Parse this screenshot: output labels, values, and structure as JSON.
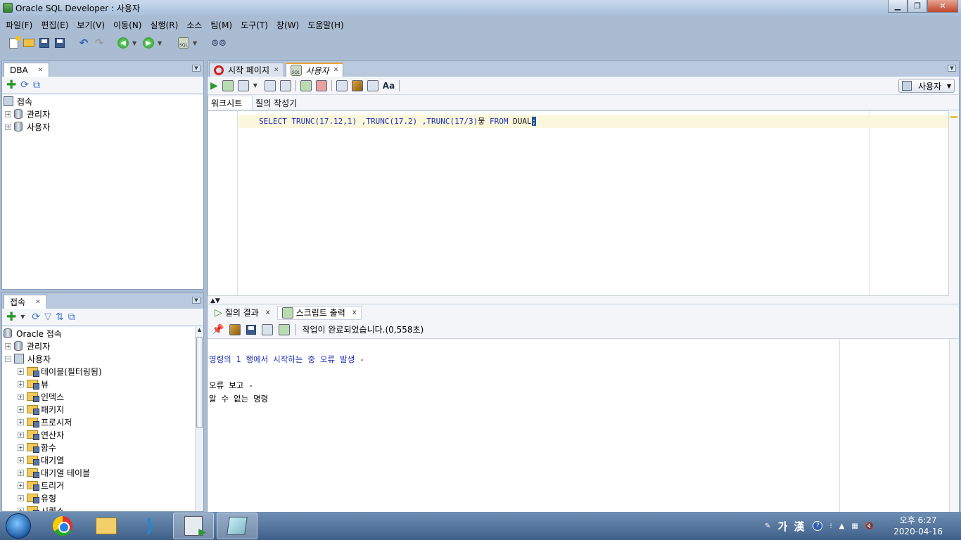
{
  "window": {
    "title": "Oracle SQL Developer : 사용자",
    "minimize": "▁",
    "maximize": "❐",
    "close": "✕"
  },
  "menu": [
    "파일(F)",
    "편집(E)",
    "보기(V)",
    "이동(N)",
    "실행(R)",
    "소스",
    "팀(M)",
    "도구(T)",
    "창(W)",
    "도움말(H)"
  ],
  "dba_panel": {
    "tab": "DBA",
    "tree": [
      {
        "label": "접속",
        "level": 0,
        "icon": "connection-icon"
      },
      {
        "label": "관리자",
        "level": 1,
        "expander": "+",
        "icon": "database-icon"
      },
      {
        "label": "사용자",
        "level": 1,
        "expander": "+",
        "icon": "database-icon"
      }
    ]
  },
  "connections_panel": {
    "tab": "접속",
    "tree": [
      {
        "label": "Oracle 접속",
        "level": 0,
        "icon": "database-icon"
      },
      {
        "label": "관리자",
        "level": 1,
        "expander": "+",
        "icon": "database-icon"
      },
      {
        "label": "사용자",
        "level": 1,
        "expander": "−",
        "icon": "connection-icon"
      },
      {
        "label": "테이블(필터링됨)",
        "level": 2,
        "expander": "+",
        "icon": "folder-icon"
      },
      {
        "label": "뷰",
        "level": 2,
        "expander": "+",
        "icon": "folder-icon"
      },
      {
        "label": "인덱스",
        "level": 2,
        "expander": "+",
        "icon": "folder-icon"
      },
      {
        "label": "패키지",
        "level": 2,
        "expander": "+",
        "icon": "folder-icon"
      },
      {
        "label": "프로시저",
        "level": 2,
        "expander": "+",
        "icon": "folder-icon"
      },
      {
        "label": "연산자",
        "level": 2,
        "expander": "+",
        "icon": "folder-icon"
      },
      {
        "label": "함수",
        "level": 2,
        "expander": "+",
        "icon": "folder-icon"
      },
      {
        "label": "대기열",
        "level": 2,
        "expander": "+",
        "icon": "folder-icon"
      },
      {
        "label": "대기열 테이블",
        "level": 2,
        "expander": "+",
        "icon": "folder-icon"
      },
      {
        "label": "트리거",
        "level": 2,
        "expander": "+",
        "icon": "folder-icon"
      },
      {
        "label": "유형",
        "level": 2,
        "expander": "+",
        "icon": "folder-icon"
      },
      {
        "label": "시퀀스",
        "level": 2,
        "expander": "+",
        "icon": "folder-icon"
      }
    ]
  },
  "editor": {
    "tabs": [
      {
        "label": "시작 페이지",
        "active": false
      },
      {
        "label": "사용자",
        "active": true
      }
    ],
    "connection_selector": "사용자",
    "sub_tabs": [
      "워크시트",
      "질의 작성기"
    ],
    "sql": {
      "kw_select": "SELECT",
      "part1": " TRUNC(17.12,1) ,TRUNC(17.2) ,TRUNC(17/3)",
      "glyph": "뭏",
      "kw_from": " FROM",
      "part2": " DUAL",
      "semicolon": ";"
    }
  },
  "results": {
    "tabs": [
      {
        "label": "질의 결과",
        "close": "x"
      },
      {
        "label": "스크립트 출력",
        "close": "x"
      }
    ],
    "status": "작업이 완료되었습니다.(0,558초)",
    "output_lines": [
      {
        "text": "명령의 1 행에서 시작하는 중 오류 발생 -",
        "error": true
      },
      {
        "text": "",
        "error": false
      },
      {
        "text": "오류 보고 -",
        "error": false
      },
      {
        "text": "알 수 없는 명령",
        "error": false
      }
    ]
  },
  "taskbar": {
    "ime": "가 漢",
    "time": "오후 6:27",
    "date": "2020-04-16"
  },
  "colors": {
    "chrome_bg": "#a9bcd2",
    "keyword": "#1a2fb8",
    "current_line": "#fbf7dc"
  }
}
